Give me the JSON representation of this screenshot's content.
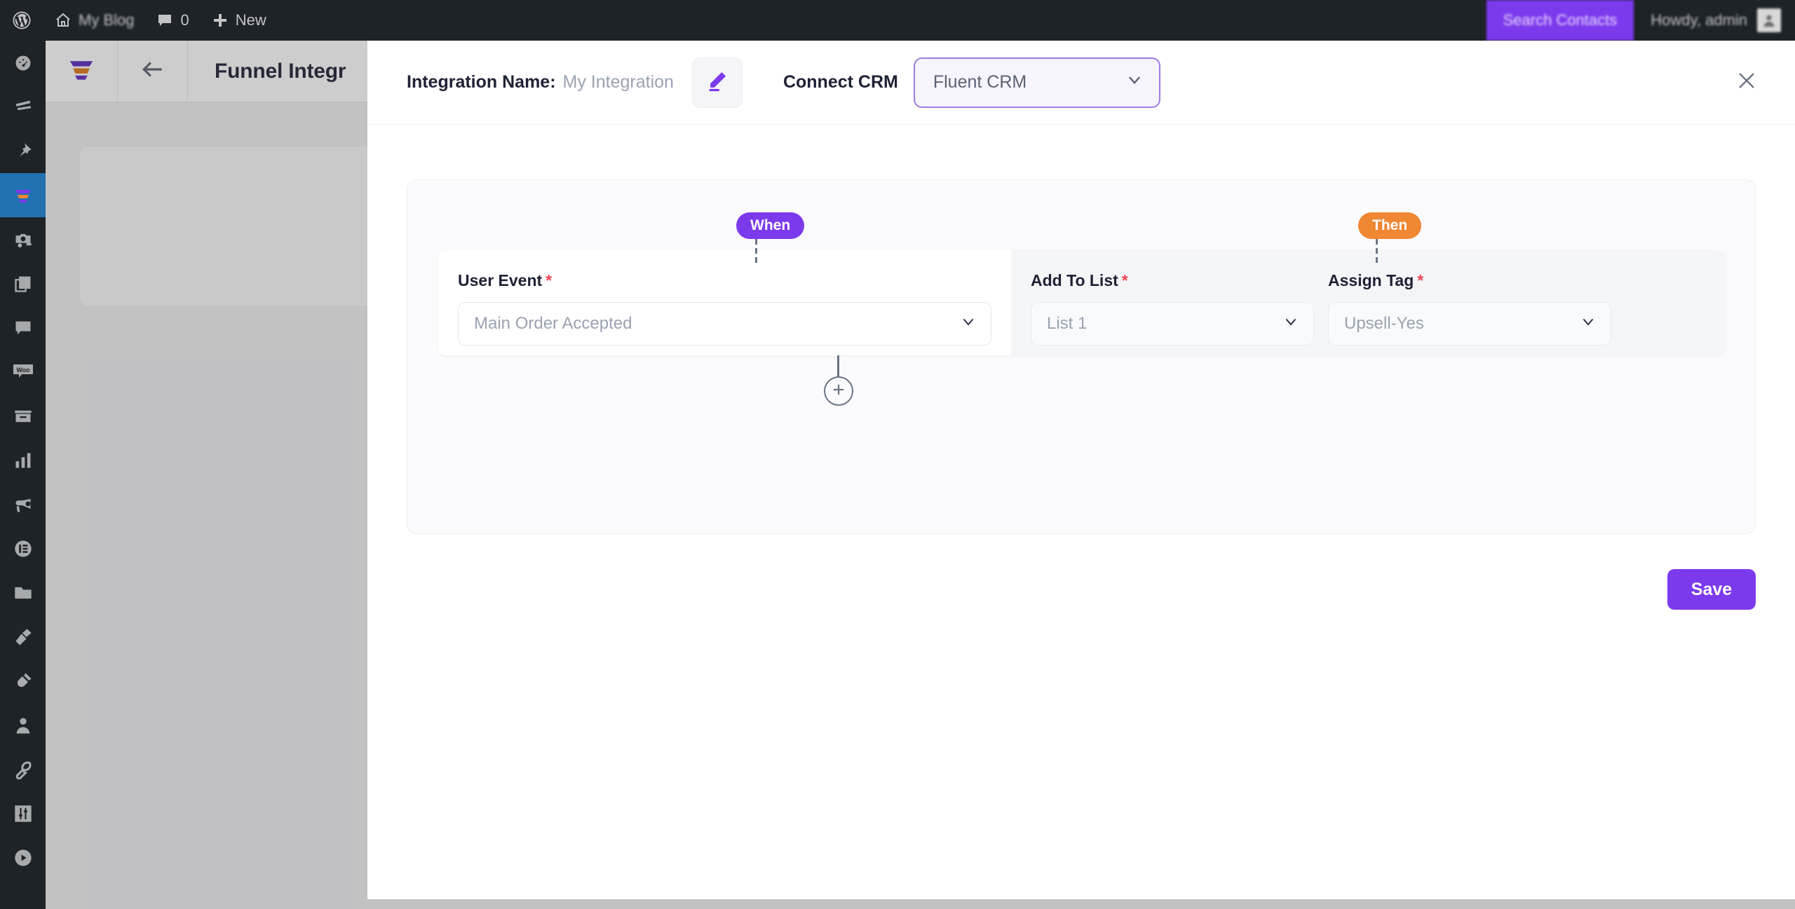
{
  "adminbar": {
    "wp_logo_icon": "wordpress-logo-icon",
    "home_icon": "home-icon",
    "site_name": "My Blog",
    "comments_icon": "comment-bubble-icon",
    "comments_count": "0",
    "new_icon": "plus-icon",
    "new_label": "New",
    "search_contacts_label": "Search Contacts",
    "howdy_label": "Howdy, admin",
    "avatar_icon": "user-avatar-icon",
    "accent_color": "#7c3aed",
    "bar_color": "#1d2327"
  },
  "sidebar": {
    "active_color": "#2271b1",
    "items": [
      {
        "name": "dashboard",
        "icon": "gauge-icon",
        "active": false
      },
      {
        "name": "posts",
        "icon": "posts-icon",
        "active": false
      },
      {
        "name": "media",
        "icon": "pin-icon",
        "active": false
      },
      {
        "name": "funnel-builder",
        "icon": "funnel-icon",
        "active": true
      },
      {
        "name": "portfolio",
        "icon": "camera-icon",
        "active": false
      },
      {
        "name": "pages",
        "icon": "pages-icon",
        "active": false
      },
      {
        "name": "comments",
        "icon": "comment-bubble-icon",
        "active": false
      },
      {
        "name": "woocommerce",
        "icon": "woo-icon",
        "active": false
      },
      {
        "name": "products",
        "icon": "product-box-icon",
        "active": false
      },
      {
        "name": "analytics",
        "icon": "bar-chart-icon",
        "active": false
      },
      {
        "name": "marketing",
        "icon": "megaphone-icon",
        "active": false
      },
      {
        "name": "elementor",
        "icon": "elementor-icon",
        "active": false
      },
      {
        "name": "templates",
        "icon": "folder-icon",
        "active": false
      },
      {
        "name": "appearance",
        "icon": "paintbrush-icon",
        "active": false
      },
      {
        "name": "plugins",
        "icon": "plug-icon",
        "active": false
      },
      {
        "name": "users",
        "icon": "user-icon",
        "active": false
      },
      {
        "name": "tools",
        "icon": "wrench-icon",
        "active": false
      },
      {
        "name": "settings",
        "icon": "sliders-icon",
        "active": false
      },
      {
        "name": "collapse-menu",
        "icon": "play-circle-icon",
        "active": false
      }
    ]
  },
  "page_behind": {
    "logo_icon": "funnel-logo-icon",
    "back_icon": "arrow-left-icon",
    "title": "Funnel Integr"
  },
  "modal": {
    "integration_name_label": "Integration Name:",
    "integration_name_value": "My Integration",
    "edit_icon": "pencil-edit-icon",
    "connect_crm_label": "Connect CRM",
    "crm_select": {
      "value": "Fluent CRM",
      "chevron_icon": "chevron-down-icon",
      "border_color": "#a07ae0",
      "background_color": "#f6f4fc"
    },
    "close_icon": "close-x-icon",
    "save_label": "Save",
    "save_color": "#7c3aed"
  },
  "workflow": {
    "when": {
      "pill_label": "When",
      "pill_color": "#7c3aed",
      "fields": [
        {
          "label": "Add To List",
          "required_marker": "*",
          "value": "Main Order Accepted",
          "chevron_icon": "chevron-down-icon"
        }
      ],
      "field_label": "User Event",
      "required_marker": "*",
      "field_value": "Main Order Accepted",
      "chevron_icon": "chevron-down-icon"
    },
    "then": {
      "pill_label": "Then",
      "pill_color": "#ef8733",
      "fields": [
        {
          "label": "Add To List",
          "required_marker": "*",
          "value": "List 1",
          "chevron_icon": "chevron-down-icon"
        },
        {
          "label": "Assign Tag",
          "required_marker": "*",
          "value": "Upsell-Yes",
          "chevron_icon": "chevron-down-icon"
        }
      ]
    },
    "add_step_icon": "plus-circle-icon"
  }
}
